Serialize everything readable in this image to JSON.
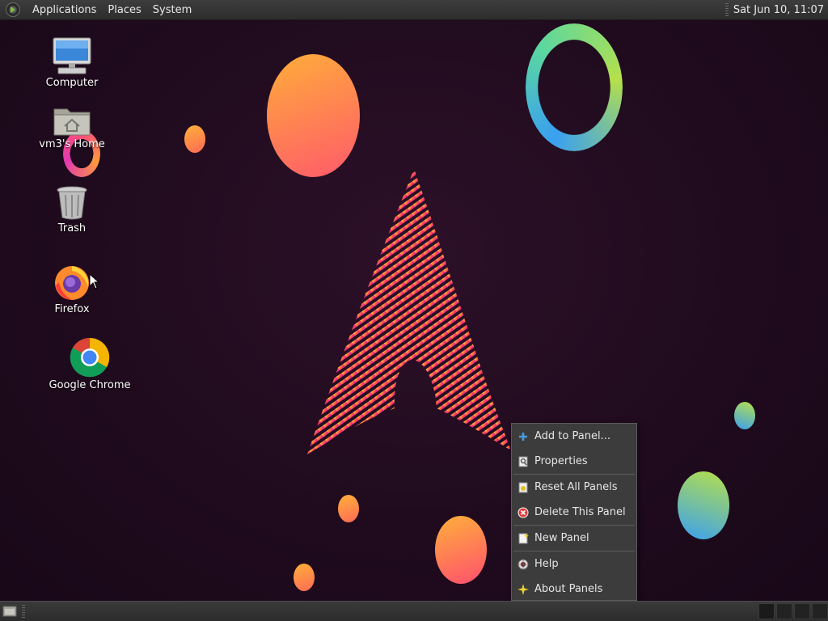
{
  "top_panel": {
    "menus": [
      "Applications",
      "Places",
      "System"
    ],
    "clock": "Sat Jun 10, 11:07"
  },
  "desktop_icons": {
    "computer": "Computer",
    "home": "vm3's Home",
    "trash": "Trash",
    "firefox": "Firefox",
    "chrome": "Google Chrome"
  },
  "context_menu": {
    "add_to_panel": "Add to Panel...",
    "properties": "Properties",
    "reset_all_panels": "Reset All Panels",
    "delete_this_panel": "Delete This Panel",
    "new_panel": "New Panel",
    "help": "Help",
    "about_panels": "About Panels"
  },
  "icons": {
    "menu_logo": "menu-logo-icon",
    "add": "plus-icon",
    "properties": "properties-icon",
    "reset": "reset-icon",
    "delete": "delete-icon",
    "new_panel": "new-panel-icon",
    "help": "help-icon",
    "about": "about-star-icon"
  },
  "colors": {
    "panel_bg": "#333333",
    "menu_bg": "#3c3c3c",
    "desktop_bg": "#200b1e"
  }
}
